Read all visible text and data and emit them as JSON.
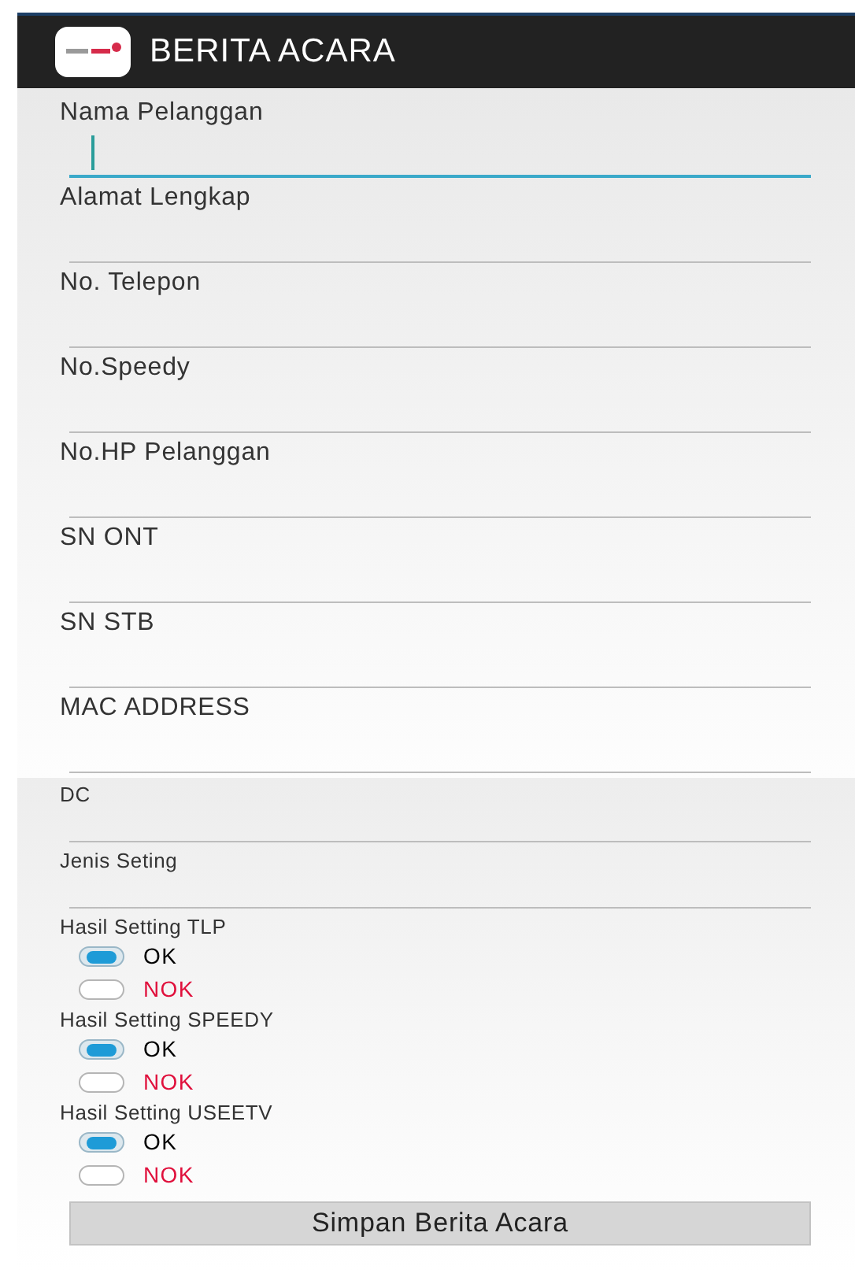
{
  "toolbar": {
    "title": "BERITA ACARA"
  },
  "fields": [
    {
      "label": "Nama Pelanggan",
      "focused": true
    },
    {
      "label": "Alamat Lengkap",
      "focused": false
    },
    {
      "label": "No. Telepon",
      "focused": false
    },
    {
      "label": "No.Speedy",
      "focused": false
    },
    {
      "label": "No.HP Pelanggan",
      "focused": false
    },
    {
      "label": "SN ONT",
      "focused": false
    },
    {
      "label": "SN STB",
      "focused": false
    },
    {
      "label": "MAC ADDRESS",
      "focused": false
    }
  ],
  "fields_2": [
    {
      "label": "DC",
      "focused": false
    },
    {
      "label": "Jenis Seting",
      "focused": false
    }
  ],
  "radio_groups": [
    {
      "label": "Hasil Setting TLP",
      "options": [
        {
          "label": "OK",
          "selected": true,
          "color": "#000000"
        },
        {
          "label": "NOK",
          "selected": false,
          "color": "#e0103c"
        }
      ]
    },
    {
      "label": "Hasil Setting SPEEDY",
      "options": [
        {
          "label": "OK",
          "selected": true,
          "color": "#000000"
        },
        {
          "label": "NOK",
          "selected": false,
          "color": "#e0103c"
        }
      ]
    },
    {
      "label": "Hasil Setting USEETV",
      "options": [
        {
          "label": "OK",
          "selected": true,
          "color": "#000000"
        },
        {
          "label": "NOK",
          "selected": false,
          "color": "#e0103c"
        }
      ]
    }
  ],
  "save_button": "Simpan Berita Acara"
}
